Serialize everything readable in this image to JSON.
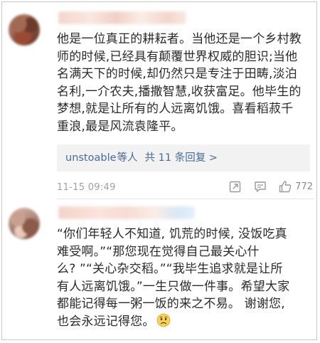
{
  "comments": [
    {
      "text": "他是一位真正的耕耘者。当他还是一个乡村教\n师的时候,已经具有颠覆世界权威的胆识;当他\n名满天下的时候,却仍然只是专注于田畴,淡泊\n名利,一介农夫,播撒智慧,收获富足。他毕生的\n梦想,就是让所有的人远离饥饿。喜看稻菽千\n重浪,最是风流袁隆平。",
      "reply": {
        "users": "unstoable",
        "suffix": " 等人",
        "count": "共 11 条回复 >"
      },
      "timestamp": "11-15 09:49",
      "likes": "772"
    },
    {
      "text": "“你们年轻人不知道, 饥荒的时候, 没饭吃真\n难受啊。”“那您现在觉得自己最关心什\n么? ”“关心杂交稻。”“我毕生追求就是让所\n有人远离饥饿。”一生只做一件事。希望大家\n都能记得每一粥一饭的来之不易。 谢谢您,\n也会永远记得您。",
      "emoji": "sad-face"
    }
  ],
  "colors": {
    "link": "#4a6a98",
    "meta": "#a0a0a0",
    "reply_bg": "#f2f2f2",
    "text": "#2a2a2a"
  },
  "icons": [
    "share-icon",
    "comment-icon",
    "like-icon"
  ]
}
